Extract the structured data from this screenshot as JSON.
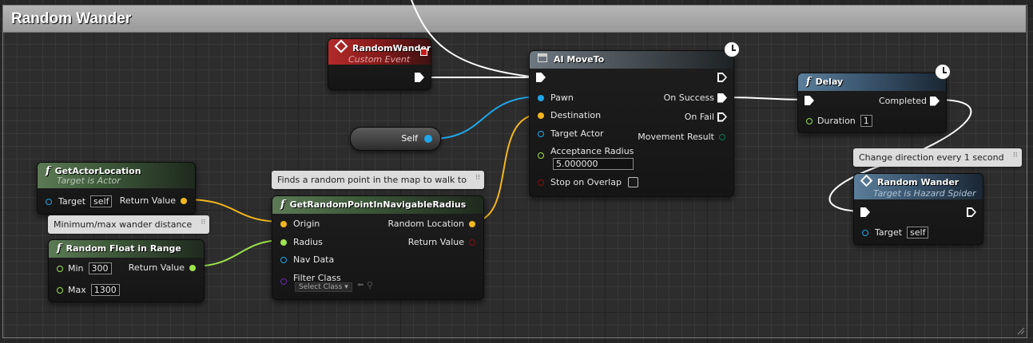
{
  "comment": {
    "title": "Random Wander"
  },
  "nodes": {
    "random_wander_event": {
      "title": "RandomWander",
      "subtitle": "Custom Event"
    },
    "self_node": {
      "label": "Self"
    },
    "ai_move_to": {
      "title": "AI MoveTo",
      "pins": {
        "pawn": "Pawn",
        "destination": "Destination",
        "target_actor": "Target Actor",
        "acceptance_radius": "Acceptance Radius",
        "acceptance_radius_value": "5.000000",
        "stop_on_overlap": "Stop on Overlap",
        "on_success": "On Success",
        "on_fail": "On Fail",
        "movement_result": "Movement Result"
      }
    },
    "delay": {
      "title": "Delay",
      "pins": {
        "completed": "Completed",
        "duration": "Duration",
        "duration_value": "1"
      }
    },
    "random_wander_call": {
      "title": "Random Wander",
      "subtitle": "Target is Hazard Spider",
      "pins": {
        "target": "Target",
        "target_value": "self"
      }
    },
    "get_actor_location": {
      "title": "GetActorLocation",
      "subtitle": "Target is Actor",
      "pins": {
        "target": "Target",
        "target_value": "self",
        "return_value": "Return Value"
      }
    },
    "random_float": {
      "title": "Random Float in Range",
      "pins": {
        "min": "Min",
        "min_value": "300",
        "max": "Max",
        "max_value": "1300",
        "return_value": "Return Value"
      }
    },
    "get_random_point": {
      "title": "GetRandomPointInNavigableRadius",
      "pins": {
        "origin": "Origin",
        "radius": "Radius",
        "nav_data": "Nav Data",
        "filter_class": "Filter Class",
        "filter_class_value": "Select Class",
        "random_location": "Random Location",
        "return_value": "Return Value"
      }
    }
  },
  "tooltips": {
    "find_point": "Finds a random point in the map to walk to",
    "wander_distance": "Minimum/max wander distance",
    "change_direction": "Change direction every 1 second"
  },
  "colors": {
    "exec": "#ffffff",
    "object": "#1fa6e8",
    "vector": "#f2b71e",
    "float": "#9ee34c",
    "bool": "#8a1010",
    "class": "#6a2aa8",
    "enum": "#007a55"
  }
}
